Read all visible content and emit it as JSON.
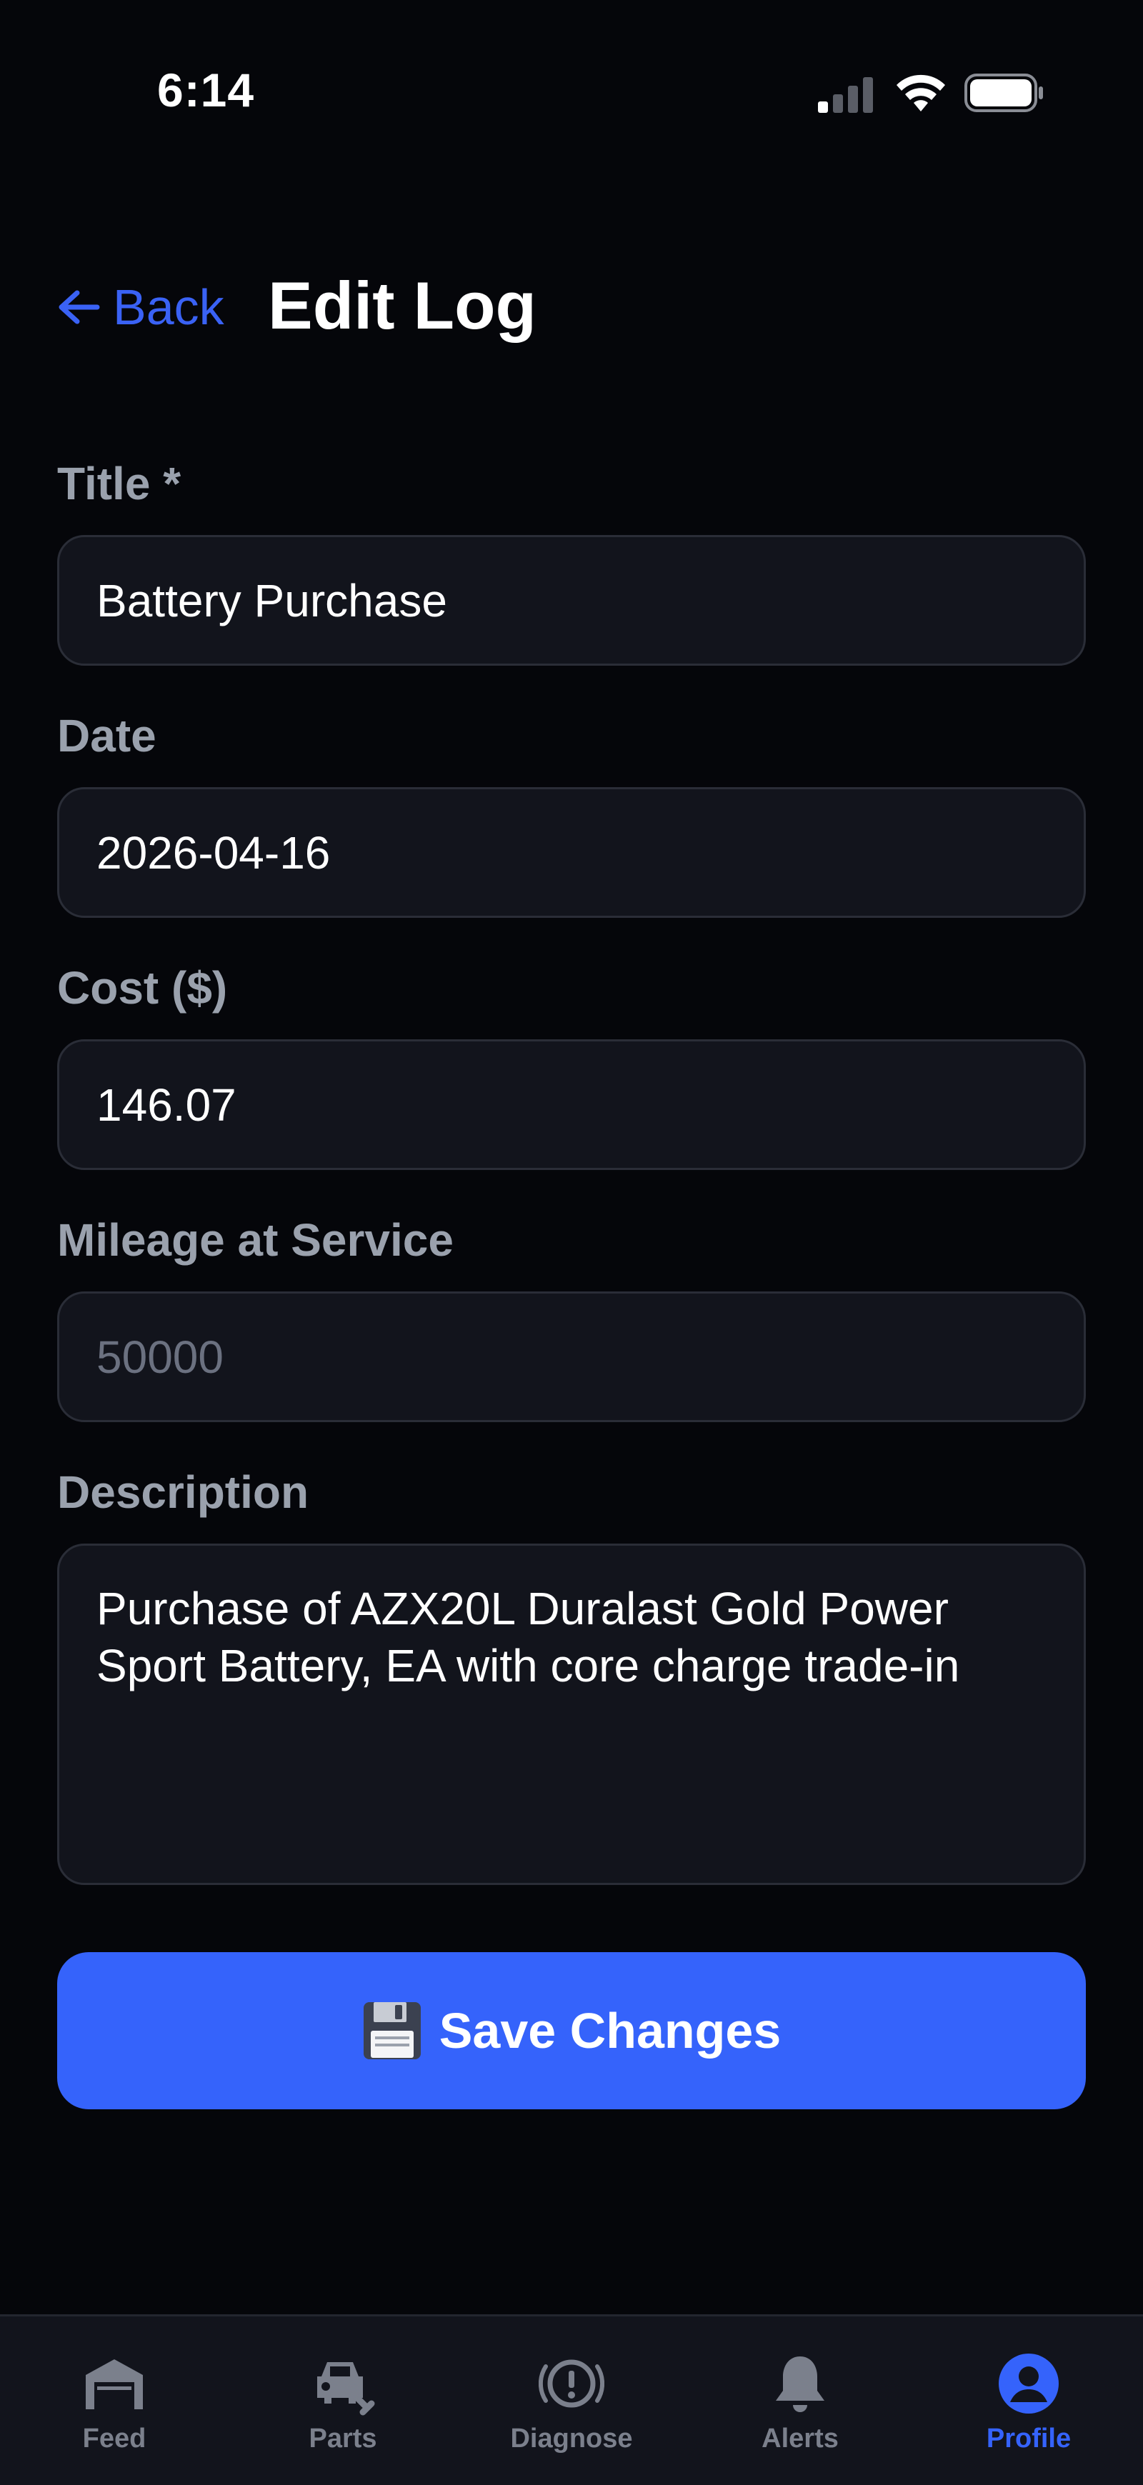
{
  "status_bar": {
    "time": "6:14"
  },
  "header": {
    "back_label": "Back",
    "title": "Edit Log"
  },
  "form": {
    "title_label": "Title *",
    "title_value": "Battery Purchase",
    "date_label": "Date",
    "date_value": "2026-04-16",
    "cost_label": "Cost ($)",
    "cost_value": "146.07",
    "mileage_label": "Mileage at Service",
    "mileage_placeholder": "50000",
    "description_label": "Description",
    "description_value": "Purchase of AZX20L Duralast Gold Power Sport Battery, EA with core charge trade-in",
    "save_label": "Save Changes",
    "save_icon": "floppy-disk-icon"
  },
  "tabs": [
    {
      "label": "Feed",
      "icon": "garage-icon",
      "active": false
    },
    {
      "label": "Parts",
      "icon": "car-wrench-icon",
      "active": false
    },
    {
      "label": "Diagnose",
      "icon": "alert-circle-icon",
      "active": false
    },
    {
      "label": "Alerts",
      "icon": "bell-icon",
      "active": false
    },
    {
      "label": "Profile",
      "icon": "user-circle-icon",
      "active": true
    }
  ],
  "colors": {
    "background": "#05060a",
    "accent": "#3563fb",
    "field_bg": "#12141c",
    "label": "#9aa1ad",
    "inactive_tab": "#7b808c"
  }
}
